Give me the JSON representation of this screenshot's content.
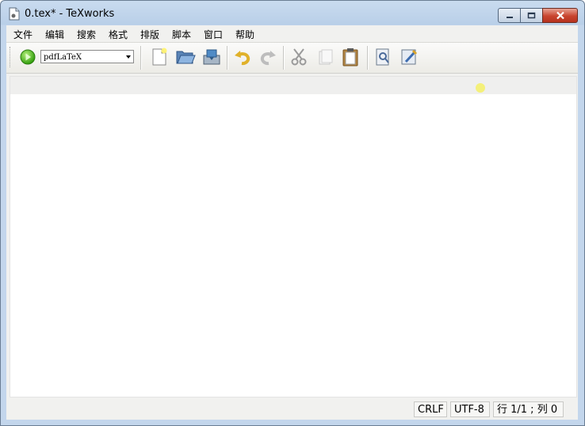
{
  "window": {
    "title": "0.tex* - TeXworks",
    "icon": "document-icon"
  },
  "menu": [
    "文件",
    "编辑",
    "搜索",
    "格式",
    "排版",
    "脚本",
    "窗口",
    "帮助"
  ],
  "toolbar": {
    "typeset_engine": "pdfLaTeX",
    "buttons": [
      "typeset-play",
      "new-document",
      "open-folder",
      "save",
      "undo",
      "redo",
      "cut",
      "copy",
      "paste",
      "preview",
      "settings"
    ]
  },
  "editor": {
    "content": ""
  },
  "status": {
    "line_ending": "CRLF",
    "encoding": "UTF-8",
    "position": "行 1/1 ; 列 0"
  },
  "colors": {
    "accent_play": "#43b512",
    "highlight_line": "#efefee",
    "cursor": "#f4f07a"
  }
}
